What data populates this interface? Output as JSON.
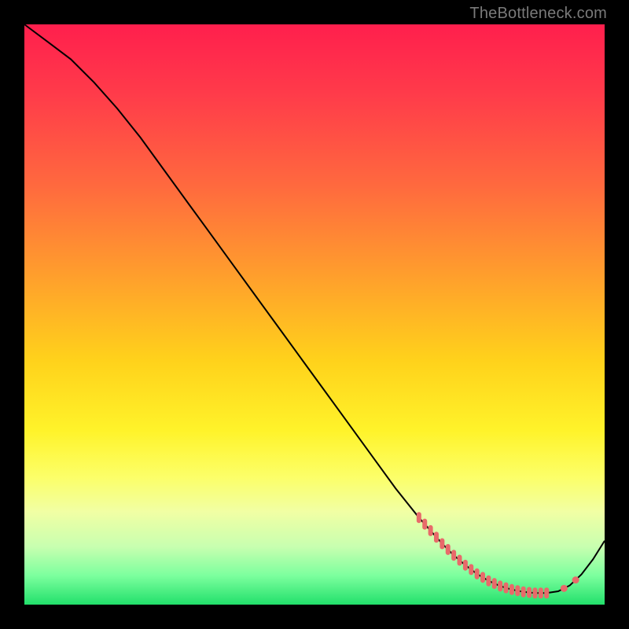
{
  "watermark": "TheBottleneck.com",
  "chart_data": {
    "type": "line",
    "title": "",
    "xlabel": "",
    "ylabel": "",
    "xlim": [
      0,
      100
    ],
    "ylim": [
      0,
      100
    ],
    "grid": false,
    "series": [
      {
        "name": "curve",
        "x": [
          0,
          4,
          8,
          12,
          16,
          20,
          24,
          28,
          32,
          36,
          40,
          44,
          48,
          52,
          56,
          60,
          64,
          68,
          72,
          74,
          76,
          78,
          80,
          82,
          84,
          86,
          88,
          90,
          92,
          94,
          96,
          98,
          100
        ],
        "y": [
          100,
          97,
          94,
          90,
          85.5,
          80.5,
          75,
          69.5,
          64,
          58.5,
          53,
          47.5,
          42,
          36.5,
          31,
          25.5,
          20,
          15,
          10.5,
          8.5,
          6.8,
          5.3,
          4.1,
          3.2,
          2.6,
          2.2,
          2.0,
          2.0,
          2.3,
          3.3,
          5.2,
          7.8,
          11
        ]
      }
    ],
    "highlight_ticks_x": [
      68,
      69,
      70,
      71,
      72,
      73,
      74,
      75,
      76,
      77,
      78,
      79,
      80,
      81,
      82,
      83,
      84,
      85,
      86,
      87,
      88,
      89,
      90
    ],
    "highlight_dots_x": [
      93,
      95
    ]
  }
}
